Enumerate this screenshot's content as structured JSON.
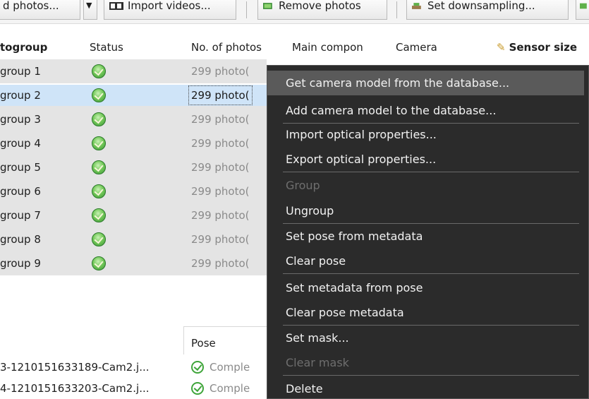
{
  "toolbar": {
    "add_photos_label": "d photos...",
    "dropdown_arrow": "▼",
    "import_videos_label": "Import videos...",
    "remove_photos_label": "Remove photos",
    "set_downsampling_label": "Set downsampling...",
    "icons": [
      "dropdown-arrow",
      "film-icon",
      "remove-photos-icon",
      "downsampling-icon"
    ]
  },
  "photogroups": {
    "columns": {
      "photogroup": "togroup",
      "status": "Status",
      "photos": "No. of photos",
      "main_component": "Main compon",
      "camera": "Camera",
      "sensor_size": "Sensor size"
    },
    "rows": [
      {
        "name": "group 1",
        "photos": "299 photo("
      },
      {
        "name": "group 2",
        "photos": "299 photo("
      },
      {
        "name": "group 3",
        "photos": "299 photo("
      },
      {
        "name": "group 4",
        "photos": "299 photo("
      },
      {
        "name": "group 5",
        "photos": "299 photo("
      },
      {
        "name": "group 6",
        "photos": "299 photo("
      },
      {
        "name": "group 7",
        "photos": "299 photo("
      },
      {
        "name": "group 8",
        "photos": "299 photo("
      },
      {
        "name": "group 9",
        "photos": "299 photo("
      }
    ],
    "selected_row": "group 2",
    "status_icon": "check-circle-icon",
    "sensor_icon": "pencil-icon"
  },
  "photos_table": {
    "pose_header": "Pose",
    "rows": [
      {
        "file": "3-1210151633189-Cam2.j...",
        "pose": "Comple"
      },
      {
        "file": "4-1210151633203-Cam2.j...",
        "pose": "Comple"
      }
    ]
  },
  "context_menu": {
    "items": [
      {
        "label": "Get camera model from the database...",
        "state": "hover"
      },
      {
        "label": "Add camera model to the database...",
        "state": "enabled"
      },
      {
        "label": "Import optical properties...",
        "state": "enabled"
      },
      {
        "label": "Export optical properties...",
        "state": "enabled"
      },
      {
        "label": "Group",
        "state": "disabled"
      },
      {
        "label": "Ungroup",
        "state": "enabled"
      },
      {
        "label": "Set pose from metadata",
        "state": "enabled"
      },
      {
        "label": "Clear pose",
        "state": "enabled"
      },
      {
        "label": "Set metadata from pose",
        "state": "enabled"
      },
      {
        "label": "Clear pose metadata",
        "state": "enabled"
      },
      {
        "label": "Set mask...",
        "state": "enabled"
      },
      {
        "label": "Clear mask",
        "state": "disabled"
      },
      {
        "label": "Delete",
        "state": "enabled"
      }
    ]
  },
  "colors": {
    "menu_bg": "#2b2b2b",
    "menu_hover": "#5a5a5a",
    "selection": "#cfe4f8",
    "row_gray": "#e4e4e4",
    "status_green": "#74c95a"
  }
}
